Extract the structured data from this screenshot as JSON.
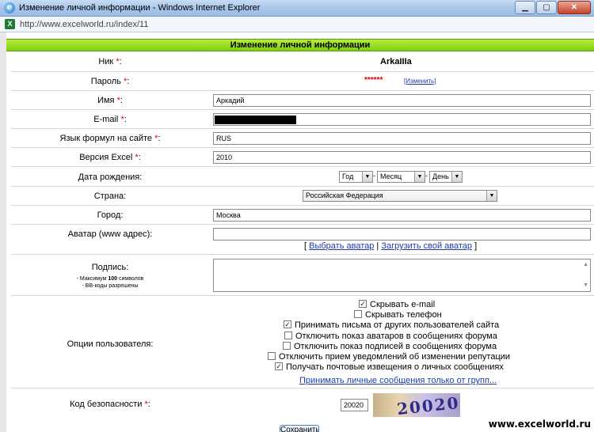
{
  "window": {
    "title": "Изменение личной информации - Windows Internet Explorer",
    "url": "http://www.excelworld.ru/index/11",
    "minimize": "▁",
    "maximize": "▢",
    "close": "✕"
  },
  "form": {
    "heading": "Изменение личной информации",
    "nick": {
      "label": "Ник",
      "value": "ArkaIIIa"
    },
    "password": {
      "label": "Пароль",
      "value": "******",
      "change_link": "[Изменить]"
    },
    "name": {
      "label": "Имя",
      "value": "Аркадий"
    },
    "email": {
      "label": "E-mail",
      "value": ""
    },
    "formula_lang": {
      "label": "Язык формул на сайте",
      "value": "RUS"
    },
    "excel_version": {
      "label": "Версия Excel",
      "value": "2010"
    },
    "birthdate": {
      "label": "Дата рождения:",
      "year": "Год",
      "month": "Месяц",
      "day": "День"
    },
    "country": {
      "label": "Страна:",
      "value": "Российская Федерация"
    },
    "city": {
      "label": "Город:",
      "value": "Москва"
    },
    "avatar": {
      "label": "Аватар (www адрес):",
      "value": "",
      "choose": "Выбрать аватар",
      "upload": "Загрузить свой аватар",
      "open": "[",
      "sep": "|",
      "close": "]"
    },
    "signature": {
      "label": "Подпись:",
      "hint1_pre": "- Максимум ",
      "hint1_num": "100",
      "hint1_post": " символов",
      "hint2": "- BB-коды разрешены"
    },
    "options": {
      "label": "Опции пользователя:",
      "items": [
        {
          "text": "Скрывать e-mail",
          "checked": true
        },
        {
          "text": "Скрывать телефон",
          "checked": false
        },
        {
          "text": "Принимать письма от других пользователей сайта",
          "checked": true
        },
        {
          "text": "Отключить показ аватаров в сообщениях форума",
          "checked": false
        },
        {
          "text": "Отключить показ подписей в сообщениях форума",
          "checked": false
        },
        {
          "text": "Отключить прием уведомлений об изменении репутации",
          "checked": false
        },
        {
          "text": "Получать почтовые извещения о личных сообщениях",
          "checked": true
        }
      ],
      "groups_link": "Принимать личные сообщения только от групп..."
    },
    "security": {
      "label": "Код безопасности",
      "value": "20020",
      "captcha": "20020"
    },
    "save": "Сохранить"
  },
  "watermark": "www.excelworld.ru"
}
